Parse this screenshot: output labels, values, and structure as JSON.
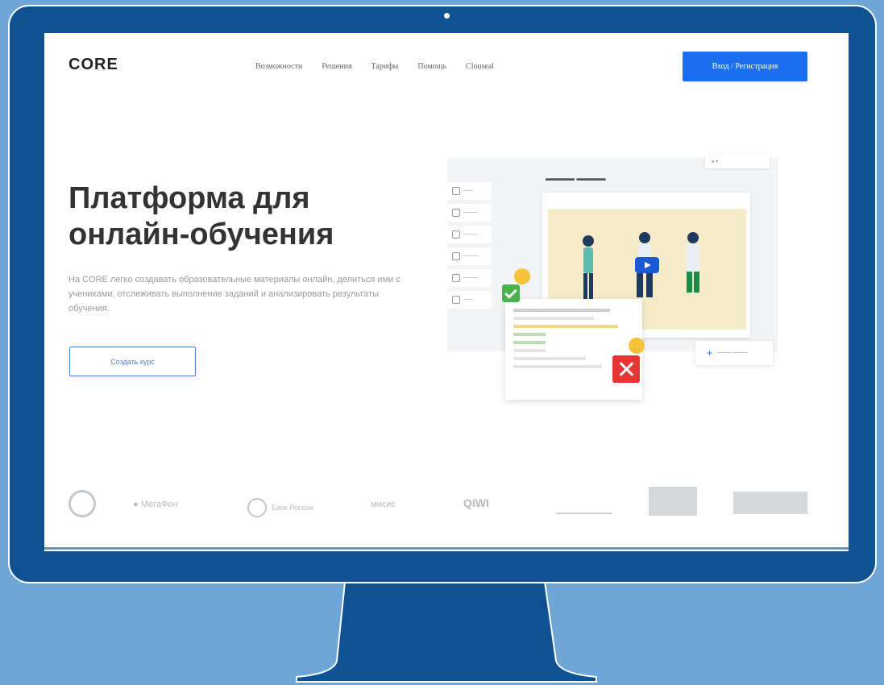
{
  "header": {
    "logo": "CORE",
    "nav": [
      "Возможности",
      "Решения",
      "Тарифы",
      "Помощь",
      "Сlouseal"
    ],
    "login_label": "Вход / Регистрация"
  },
  "hero": {
    "title_line1": "Платформа для",
    "title_line2": "онлайн-обучения",
    "lead": "На CORE легко создавать образовательные материалы онлайн, делиться ими с учениками, отслеживать выполнение заданий и анализировать результаты обучения.",
    "cta_label": "Создать курс"
  },
  "partners": {
    "megafon": "МегаФон",
    "cbr": "Банк России",
    "misis": "мисис",
    "qiwi": "QIWI"
  },
  "colors": {
    "background": "#6fa6d8",
    "monitor": "#0e5293",
    "accent": "#1a6ef0",
    "success": "#48b24f",
    "error": "#e53636"
  },
  "icons": [
    "monitor-camera-icon",
    "play-icon",
    "check-icon",
    "close-icon",
    "plus-icon",
    "emoji-icon"
  ]
}
